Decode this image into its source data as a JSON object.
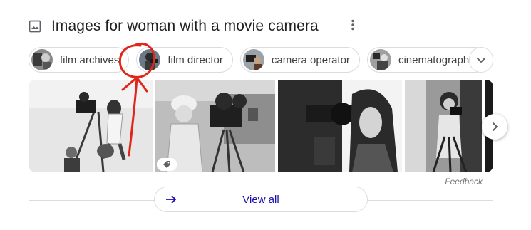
{
  "header": {
    "title": "Images for woman with a movie camera",
    "icon": "image-icon",
    "more_icon": "more-vert-icon"
  },
  "chips": [
    {
      "label": "film archives",
      "thumb": "film-archives-thumbnail"
    },
    {
      "label": "film director",
      "thumb": "film-director-thumbnail"
    },
    {
      "label": "camera operator",
      "thumb": "camera-operator-thumbnail"
    },
    {
      "label": "cinematographer",
      "thumb": "cinematographer-thumbnail"
    }
  ],
  "expand_icon": "chevron-down-icon",
  "images": [
    {
      "name": "woman-on-ladder-with-camera-photo"
    },
    {
      "name": "woman-in-cloche-hat-with-camera-photo",
      "badge_icon": "tag-icon"
    },
    {
      "name": "woman-looking-through-camera-photo"
    },
    {
      "name": "woman-behind-tripod-camera-photo"
    },
    {
      "name": "partial-film-photo"
    }
  ],
  "next_icon": "chevron-right-icon",
  "feedback": "Feedback",
  "view_all": {
    "label": "View all",
    "icon": "arrow-right-icon"
  },
  "annotation": {
    "shape": "red-hand-drawn-circle-and-arrow",
    "color": "#e0261b"
  },
  "colors": {
    "link": "#1a0dab",
    "border": "#dadce0",
    "text": "#202124",
    "muted": "#70757a"
  }
}
